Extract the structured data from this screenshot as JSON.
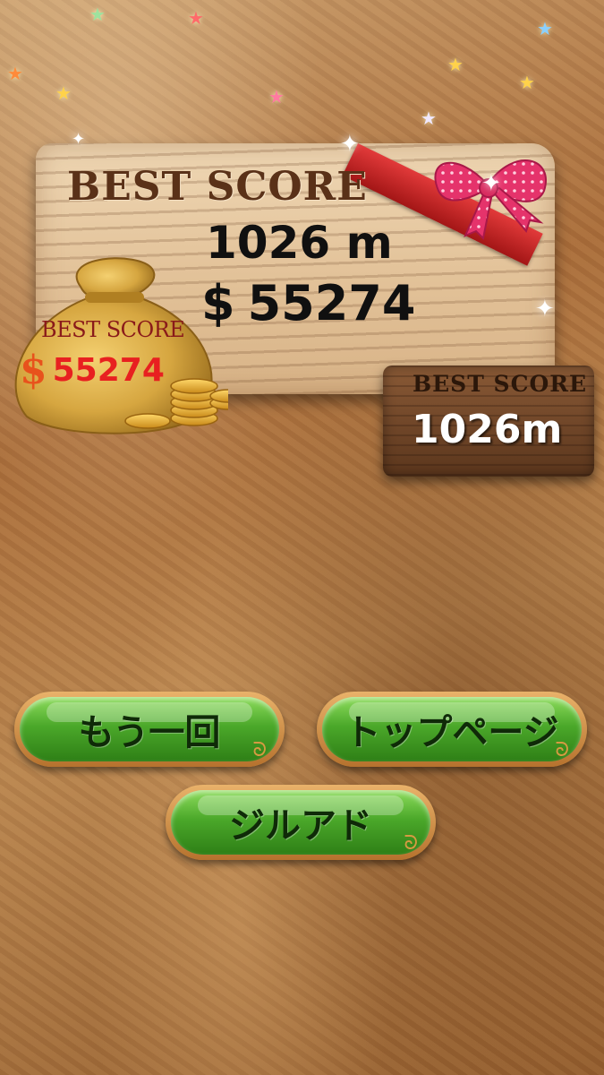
{
  "main_board": {
    "title": "BEST SCORE",
    "distance": "1026 m",
    "money_symbol": "$",
    "money_value": "55274"
  },
  "money_bag": {
    "title": "BEST SCORE",
    "symbol": "$",
    "value": "55274"
  },
  "plank": {
    "title": "BEST SCORE",
    "value": "1026m"
  },
  "buttons": {
    "retry": "もう一回",
    "top_page": "トップページ",
    "more": "ジルアド"
  },
  "colors": {
    "button_green": "#4ba82a",
    "money_red": "#e82020",
    "wood_dark": "#6d4427"
  }
}
